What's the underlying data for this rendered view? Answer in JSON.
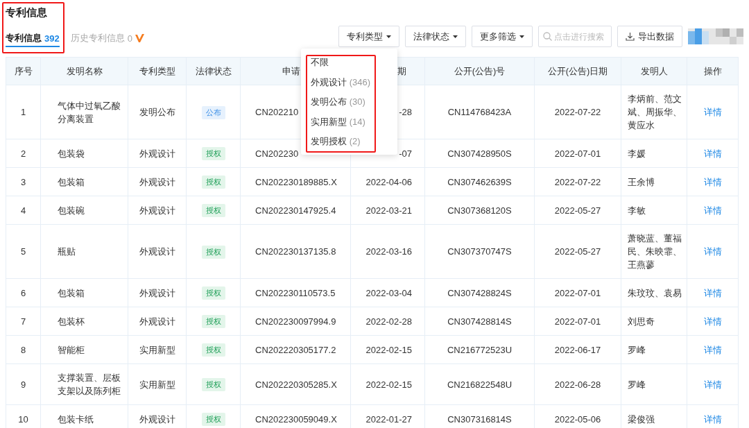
{
  "title": "专利信息",
  "tabs": [
    {
      "label": "专利信息",
      "count": "392",
      "selected": true,
      "vip": false
    },
    {
      "label": "历史专利信息",
      "count": "0",
      "selected": false,
      "vip": true
    }
  ],
  "toolbar": {
    "filters": [
      "专利类型",
      "法律状态",
      "更多筛选"
    ],
    "search": {
      "placeholder": "点击进行搜索"
    },
    "export": "导出数据"
  },
  "dropdown": {
    "items": [
      {
        "label": "不限"
      },
      {
        "label": "外观设计",
        "count": "(346)"
      },
      {
        "label": "发明公布",
        "count": "(30)"
      },
      {
        "label": "实用新型",
        "count": "(14)"
      },
      {
        "label": "发明授权",
        "count": "(2)"
      }
    ]
  },
  "table": {
    "columns": [
      "序号",
      "发明名称",
      "专利类型",
      "法律状态",
      "申请",
      "期",
      "公开(公告)号",
      "公开(公告)日期",
      "发明人",
      "操作"
    ],
    "rows": [
      {
        "no": "1",
        "name": "气体中过氧乙酸分离装置",
        "type": "发明公布",
        "status": {
          "text": "公布",
          "kind": "published"
        },
        "app_no": "CN202210",
        "app_date": "-28",
        "pub_no": "CN114768423A",
        "pub_date": "2022-07-22",
        "inventors": "李炳前、范文斌、周振华、黄应水",
        "action": "详情"
      },
      {
        "no": "2",
        "name": "包装袋",
        "type": "外观设计",
        "status": {
          "text": "授权",
          "kind": "granted"
        },
        "app_no": "CN202230",
        "app_date": "-07",
        "pub_no": "CN307428950S",
        "pub_date": "2022-07-01",
        "inventors": "李媛",
        "action": "详情"
      },
      {
        "no": "3",
        "name": "包装箱",
        "type": "外观设计",
        "status": {
          "text": "授权",
          "kind": "granted"
        },
        "app_no": "CN202230189885.X",
        "app_date": "2022-04-06",
        "pub_no": "CN307462639S",
        "pub_date": "2022-07-22",
        "inventors": "王余博",
        "action": "详情"
      },
      {
        "no": "4",
        "name": "包装碗",
        "type": "外观设计",
        "status": {
          "text": "授权",
          "kind": "granted"
        },
        "app_no": "CN202230147925.4",
        "app_date": "2022-03-21",
        "pub_no": "CN307368120S",
        "pub_date": "2022-05-27",
        "inventors": "李敏",
        "action": "详情"
      },
      {
        "no": "5",
        "name": "瓶贴",
        "type": "外观设计",
        "status": {
          "text": "授权",
          "kind": "granted"
        },
        "app_no": "CN202230137135.8",
        "app_date": "2022-03-16",
        "pub_no": "CN307370747S",
        "pub_date": "2022-05-27",
        "inventors": "萧晓蓝、董福民、朱映霏、王燕蓼",
        "action": "详情"
      },
      {
        "no": "6",
        "name": "包装箱",
        "type": "外观设计",
        "status": {
          "text": "授权",
          "kind": "granted"
        },
        "app_no": "CN202230110573.5",
        "app_date": "2022-03-04",
        "pub_no": "CN307428824S",
        "pub_date": "2022-07-01",
        "inventors": "朱玟玟、袁易",
        "action": "详情"
      },
      {
        "no": "7",
        "name": "包装杯",
        "type": "外观设计",
        "status": {
          "text": "授权",
          "kind": "granted"
        },
        "app_no": "CN202230097994.9",
        "app_date": "2022-02-28",
        "pub_no": "CN307428814S",
        "pub_date": "2022-07-01",
        "inventors": "刘思奇",
        "action": "详情"
      },
      {
        "no": "8",
        "name": "智能柜",
        "type": "实用新型",
        "status": {
          "text": "授权",
          "kind": "granted"
        },
        "app_no": "CN202220305177.2",
        "app_date": "2022-02-15",
        "pub_no": "CN216772523U",
        "pub_date": "2022-06-17",
        "inventors": "罗峰",
        "action": "详情"
      },
      {
        "no": "9",
        "name": "支撑装置、层板支架以及陈列柜",
        "type": "实用新型",
        "status": {
          "text": "授权",
          "kind": "granted"
        },
        "app_no": "CN202220305285.X",
        "app_date": "2022-02-15",
        "pub_no": "CN216822548U",
        "pub_date": "2022-06-28",
        "inventors": "罗峰",
        "action": "详情"
      },
      {
        "no": "10",
        "name": "包装卡纸",
        "type": "外观设计",
        "status": {
          "text": "授权",
          "kind": "granted"
        },
        "app_no": "CN202230059049.X",
        "app_date": "2022-01-27",
        "pub_no": "CN307316814S",
        "pub_date": "2022-05-06",
        "inventors": "梁俊强",
        "action": "详情"
      }
    ]
  }
}
